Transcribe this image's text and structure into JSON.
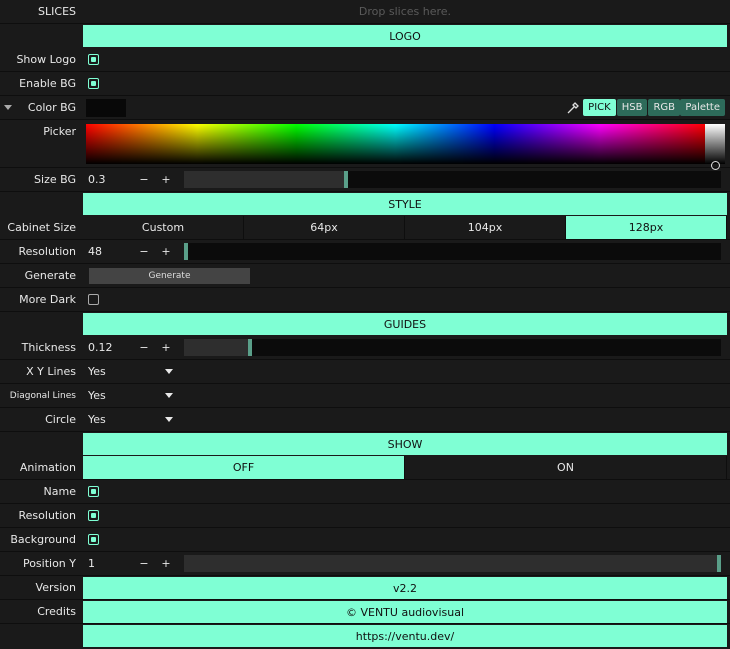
{
  "slices": {
    "label": "SLICES",
    "drop_placeholder": "Drop slices here."
  },
  "logo": {
    "header": "LOGO",
    "show_logo": "Show Logo",
    "enable_bg": "Enable BG",
    "color_bg": "Color BG",
    "modes": [
      "PICK",
      "HSB",
      "RGB"
    ],
    "palette": "Palette",
    "picker": "Picker",
    "size_bg": {
      "label": "Size BG",
      "value": "0.3",
      "fraction": 0.3
    },
    "color_bg_value": "#080808"
  },
  "style": {
    "header": "STYLE",
    "cabinet_size": {
      "label": "Cabinet Size",
      "options": [
        "Custom",
        "64px",
        "104px",
        "128px"
      ],
      "selected": "128px"
    },
    "resolution": {
      "label": "Resolution",
      "value": "48",
      "fraction": 0.0
    },
    "generate": {
      "label": "Generate",
      "button": "Generate"
    },
    "more_dark": {
      "label": "More Dark",
      "checked": false
    }
  },
  "guides": {
    "header": "GUIDES",
    "thickness": {
      "label": "Thickness",
      "value": "0.12",
      "fraction": 0.12
    },
    "xy_lines": {
      "label": "X Y Lines",
      "value": "Yes"
    },
    "diagonal_lines": {
      "label": "Diagonal Lines",
      "value": "Yes"
    },
    "circle": {
      "label": "Circle",
      "value": "Yes"
    }
  },
  "show": {
    "header": "SHOW",
    "animation": {
      "label": "Animation",
      "options": [
        "OFF",
        "ON"
      ],
      "selected": "OFF"
    },
    "name": "Name",
    "resolution": "Resolution",
    "background": "Background",
    "position_y": {
      "label": "Position Y",
      "value": "1",
      "fraction": 1.0
    }
  },
  "version": {
    "label": "Version",
    "value": "v2.2"
  },
  "credits": {
    "label": "Credits",
    "value": "© VENTU audiovisual",
    "url": "https://ventu.dev/"
  },
  "controls": {
    "minus": "−",
    "plus": "+"
  },
  "colors": {
    "accent": "#7fffd4",
    "panel": "#1a1a1a",
    "knob": "#5a9f89"
  }
}
